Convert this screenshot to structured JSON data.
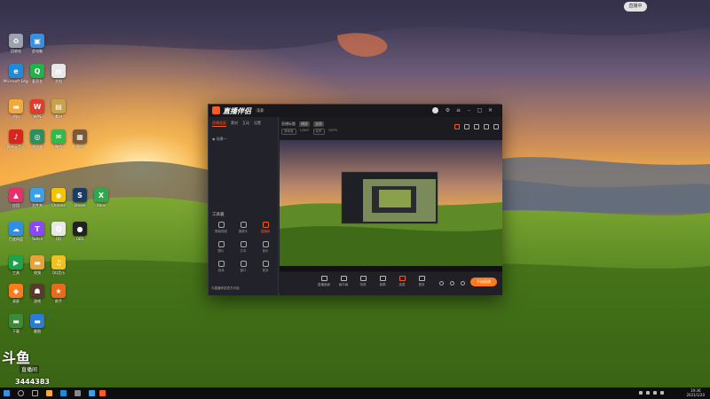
{
  "desktop": {
    "icons": [
      {
        "name": "recycle-bin",
        "label": "回收站",
        "color": "#9aa3ad",
        "glyph": "♻"
      },
      {
        "name": "computer",
        "label": "此电脑",
        "color": "#3b8fe0",
        "glyph": "▣"
      },
      {
        "name": "edge",
        "label": "Microsoft Edge",
        "color": "#1f8ad8",
        "glyph": "e"
      },
      {
        "name": "iqiyi",
        "label": "爱奇艺",
        "color": "#21b24b",
        "glyph": "Q"
      },
      {
        "name": "file-a",
        "label": "文档",
        "color": "#e8e8e8",
        "glyph": "▤"
      },
      {
        "name": "folder-a",
        "label": "资料",
        "color": "#f2a93b",
        "glyph": "▬"
      },
      {
        "name": "wps",
        "label": "WPS",
        "color": "#e23b2e",
        "glyph": "W"
      },
      {
        "name": "file-b",
        "label": "素材",
        "color": "#c9a24a",
        "glyph": "▤"
      },
      {
        "name": "netease",
        "label": "网易云音乐",
        "color": "#d8261f",
        "glyph": "♪"
      },
      {
        "name": "globe",
        "label": "浏览器",
        "color": "#2c8f5e",
        "glyph": "◎"
      },
      {
        "name": "wechat",
        "label": "微信",
        "color": "#33b849",
        "glyph": "✉"
      },
      {
        "name": "pic",
        "label": "图片",
        "color": "#7a5a3a",
        "glyph": "▦"
      },
      {
        "name": "app-blue",
        "label": "应用",
        "color": "#e5306a",
        "glyph": "▲"
      },
      {
        "name": "folder-b",
        "label": "文件夹",
        "color": "#3aa0e8",
        "glyph": "▬"
      },
      {
        "name": "chrome",
        "label": "Chrome",
        "color": "#f2c300",
        "glyph": "◉"
      },
      {
        "name": "steam",
        "label": "Steam",
        "color": "#1b3b63",
        "glyph": "S"
      },
      {
        "name": "xbox",
        "label": "Xbox",
        "color": "#2fa84f",
        "glyph": "X"
      },
      {
        "name": "baidu",
        "label": "百度网盘",
        "color": "#2f8fe8",
        "glyph": "☁"
      },
      {
        "name": "twitch",
        "label": "Twitch",
        "color": "#8b47ff",
        "glyph": "T"
      },
      {
        "name": "qq",
        "label": "QQ",
        "color": "#e8e8e8",
        "glyph": "Q"
      },
      {
        "name": "obs",
        "label": "OBS",
        "color": "#222",
        "glyph": "●"
      },
      {
        "name": "green-app",
        "label": "工具",
        "color": "#1fa34a",
        "glyph": "▶"
      },
      {
        "name": "folder-c",
        "label": "视频",
        "color": "#e8a23b",
        "glyph": "▬"
      },
      {
        "name": "qq2",
        "label": "QQ音乐",
        "color": "#f0c020",
        "glyph": "♫"
      },
      {
        "name": "orange-app",
        "label": "录屏",
        "color": "#ff7a1a",
        "glyph": "◆"
      },
      {
        "name": "game-a",
        "label": "游戏",
        "color": "#5a3a2a",
        "glyph": "☗"
      },
      {
        "name": "game-b",
        "label": "助手",
        "color": "#e86a1a",
        "glyph": "★"
      },
      {
        "name": "folder-d",
        "label": "下载",
        "color": "#3a8a3a",
        "glyph": "▬"
      },
      {
        "name": "folder-e",
        "label": "截图",
        "color": "#2a7ad8",
        "glyph": "▬"
      }
    ]
  },
  "app": {
    "name": "直播伴侣",
    "version": "1.0",
    "tabs": [
      "直播画面",
      "素材",
      "互动",
      "设置"
    ],
    "scene_label": "场景一",
    "tools_title": "工具箱",
    "left_tools": [
      "屏幕录制",
      "摄像头",
      "直播间",
      "图片",
      "文本",
      "音乐",
      "游戏",
      "窗口",
      "更多"
    ],
    "footer": "与直播伴侣官方对话",
    "top_title": "直播标题",
    "top_badges": [
      "横屏",
      "竖屏"
    ],
    "sub_chips": [
      "清晰度",
      "1080P",
      "帧率",
      "30FPS"
    ],
    "bottom_tools": [
      "直播画面",
      "画中画",
      "特效",
      "音频",
      "连麦",
      "更多"
    ],
    "live_label": "开始直播"
  },
  "overlay": {
    "watermark_logo": "斗鱼",
    "watermark_label": "直播间",
    "watermark_count": "3444383",
    "top_badge": "直播中"
  },
  "taskbar": {
    "time": "19:36",
    "date": "2021/1/20"
  }
}
